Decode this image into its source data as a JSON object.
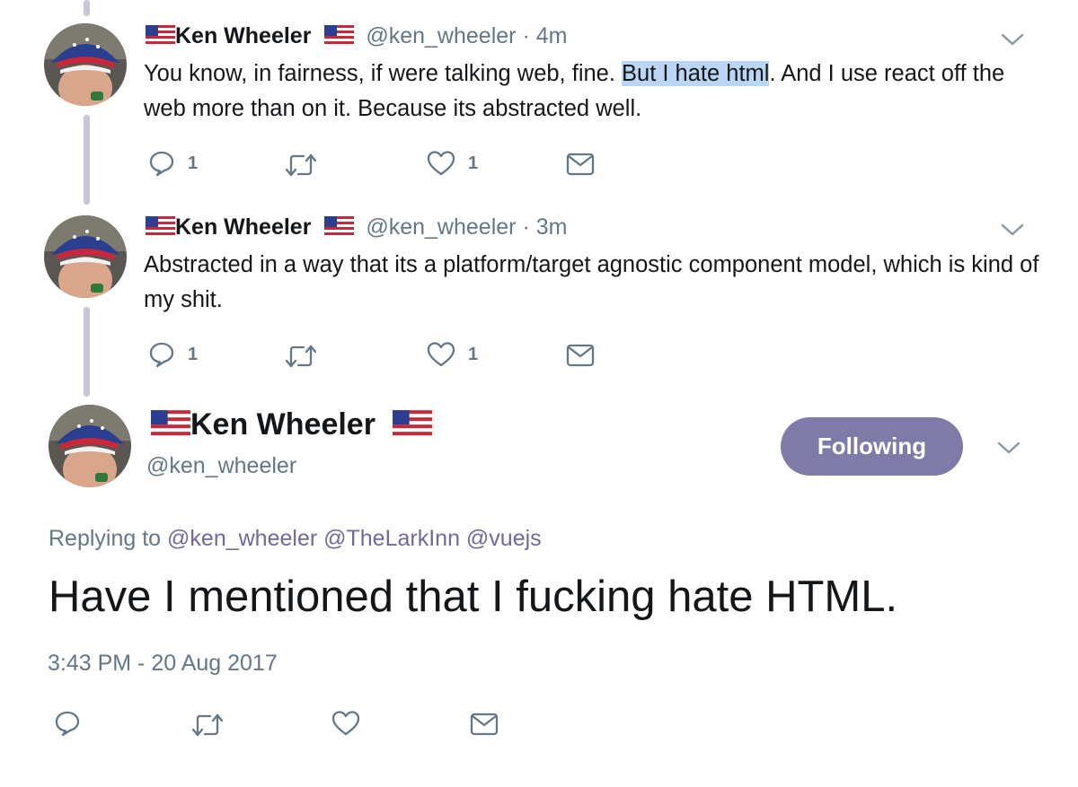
{
  "tweets": [
    {
      "display_name": "Ken Wheeler",
      "handle": "@ken_wheeler",
      "separator": "·",
      "time": "4m",
      "text_before": "You know, in fairness, if were talking web, fine. ",
      "text_highlight": "But I hate html",
      "text_after": ". And I use react off the web more than on it. Because its abstracted well.",
      "reply_count": "1",
      "like_count": "1"
    },
    {
      "display_name": "Ken Wheeler",
      "handle": "@ken_wheeler",
      "separator": "·",
      "time": "3m",
      "text": "Abstracted in a way that its a platform/target agnostic component model, which is kind of my shit.",
      "reply_count": "1",
      "like_count": "1"
    }
  ],
  "main": {
    "display_name": "Ken Wheeler",
    "handle": "@ken_wheeler",
    "follow_label": "Following",
    "replying_prefix": "Replying to",
    "mentions": [
      "@ken_wheeler",
      "@TheLarkInn",
      "@vuejs"
    ],
    "text": "Have I mentioned that I fucking hate HTML.",
    "timestamp": "3:43 PM - 20 Aug 2017"
  },
  "colors": {
    "follow_button": "#7f7ba8",
    "thread_line": "#c9c6d9",
    "secondary_text": "#657786",
    "highlight": "#bbd6f4"
  },
  "icons": [
    "reply-icon",
    "retweet-icon",
    "like-icon",
    "dm-icon",
    "chevron-down-icon",
    "us-flag-icon"
  ]
}
